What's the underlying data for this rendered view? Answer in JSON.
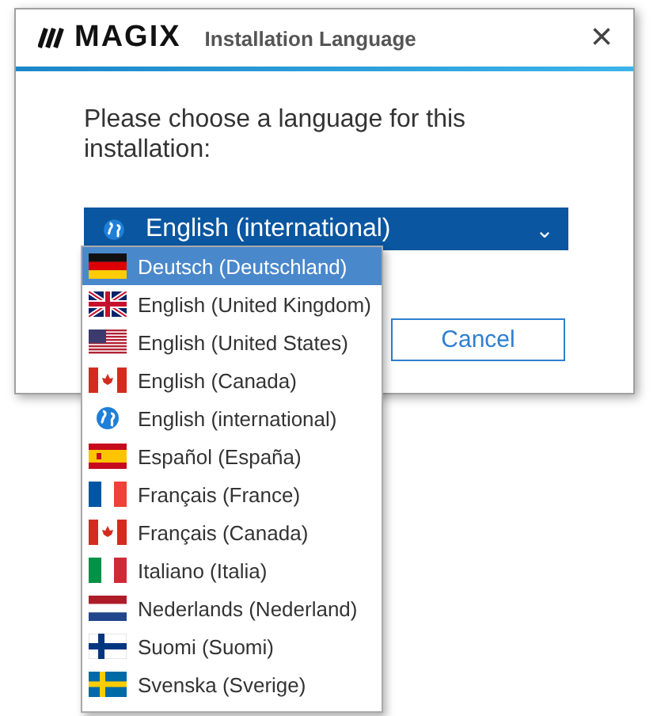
{
  "window": {
    "logo": "MAGIX",
    "title": "Installation Language",
    "close": "×"
  },
  "prompt": "Please choose a language for this installation:",
  "language_select": {
    "value": "English (international)",
    "kind": "globe",
    "expanded": true,
    "caret": "⌄"
  },
  "options": [
    {
      "label": "Deutsch (Deutschland)",
      "kind": "de",
      "selected": true
    },
    {
      "label": "English (United Kingdom)",
      "kind": "gb",
      "selected": false
    },
    {
      "label": "English (United States)",
      "kind": "us",
      "selected": false
    },
    {
      "label": "English (Canada)",
      "kind": "ca",
      "selected": false
    },
    {
      "label": "English (international)",
      "kind": "globe",
      "selected": false
    },
    {
      "label": "Español (España)",
      "kind": "es",
      "selected": false
    },
    {
      "label": "Français (France)",
      "kind": "fr",
      "selected": false
    },
    {
      "label": "Français (Canada)",
      "kind": "ca",
      "selected": false
    },
    {
      "label": "Italiano (Italia)",
      "kind": "it",
      "selected": false
    },
    {
      "label": "Nederlands (Nederland)",
      "kind": "nl",
      "selected": false
    },
    {
      "label": "Suomi (Suomi)",
      "kind": "fi",
      "selected": false
    },
    {
      "label": "Svenska (Sverige)",
      "kind": "se",
      "selected": false
    }
  ],
  "buttons": [
    {
      "label": "Cancel"
    }
  ]
}
